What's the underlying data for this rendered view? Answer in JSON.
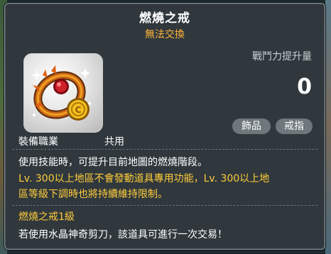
{
  "item": {
    "name": "燃燒之戒",
    "trade_status": "無法交換",
    "icon": "burning-ring-icon",
    "equip_job_label": "裝備職業",
    "equip_job_value": "共用",
    "combat_power_label": "戰鬥力提升量",
    "combat_power_value": "0",
    "tags": [
      "飾品",
      "戒指"
    ],
    "description": "使用技能時，可提升目前地圖的燃燒階段。",
    "notice_line1": "Lv. 300以上地區不會發動道具專用功能，Lv. 300以上地",
    "notice_line2": "區等級下調時也將持續維持限制。",
    "level_text": "燃燒之戒1級",
    "scissors_text": "若使用水晶神奇剪刀，該道具可進行一次交易！"
  },
  "colors": {
    "panel_bg": "#30383d",
    "trade_orange": "#ffb43a",
    "notice_yellow": "#ffcc3a",
    "tag_bg": "#6e777b"
  }
}
